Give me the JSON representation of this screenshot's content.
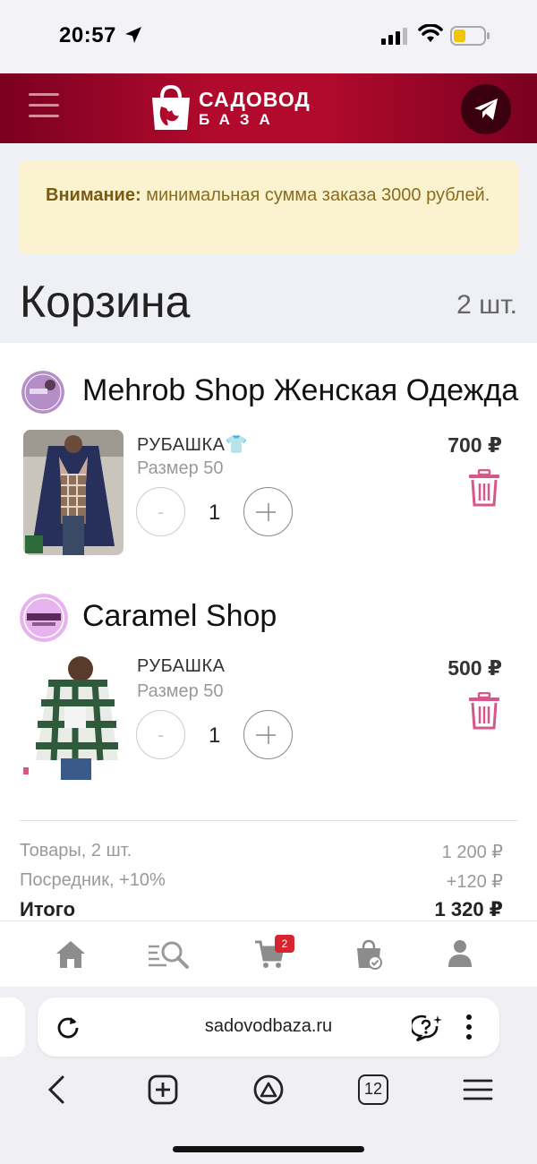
{
  "status_bar": {
    "time": "20:57"
  },
  "header": {
    "logo_line1": "САДОВОД",
    "logo_line2": "БАЗА"
  },
  "notice": {
    "bold": "Внимание:",
    "text": " минимальная сумма заказа 3000 рублей."
  },
  "cart": {
    "title": "Корзина",
    "count": "2 шт."
  },
  "shops": [
    {
      "name": "Mehrob Shop Женская Одежда",
      "item": {
        "name": "РУБАШКА👕",
        "size": "Размер 50",
        "qty": "1",
        "price": "700 ₽"
      }
    },
    {
      "name": "Caramel Shop",
      "item": {
        "name": "РУБАШКА",
        "size": "Размер 50",
        "qty": "1",
        "price": "500 ₽"
      }
    }
  ],
  "summary": {
    "goods_label": "Товары, 2 шт.",
    "goods_value": "1 200 ₽",
    "fee_label": "Посредник, +10%",
    "fee_value": "+120 ₽",
    "total_label": "Итого",
    "total_value": "1 320 ₽"
  },
  "bottom_nav": {
    "items": [
      "home-icon",
      "search-icon",
      "cart-icon",
      "orders-icon",
      "profile-icon"
    ],
    "cart_badge": "2"
  },
  "browser": {
    "url": "sadovodbaza.ru",
    "tab_count": "12"
  },
  "colors": {
    "brand": "#b10a2c",
    "accent_pink": "#d8578a",
    "notice_bg": "#fbf2d0",
    "badge": "#d8242f"
  }
}
